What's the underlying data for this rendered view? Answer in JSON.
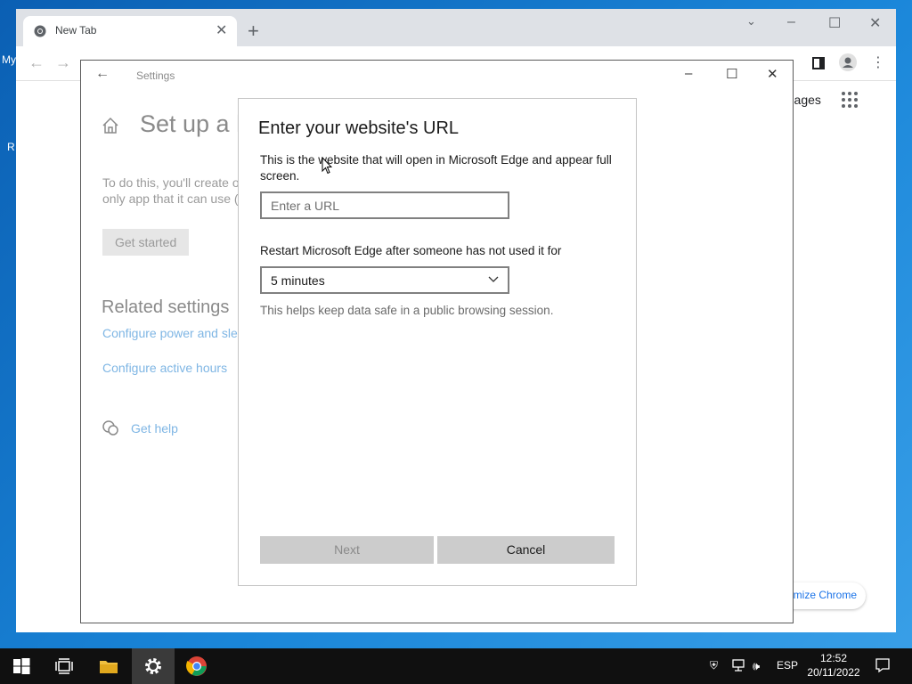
{
  "desktop": {
    "frag_top": "My",
    "frag_mid": "R"
  },
  "chrome": {
    "tab_title": "New Tab",
    "images_link": "Images",
    "customize_label": "omize Chrome"
  },
  "settings": {
    "window_title": "Settings",
    "heading": "Set up a k",
    "desc_line1": "To do this, you'll create o",
    "desc_line2": "only app that it can use (",
    "get_started": "Get started",
    "related_heading": "Related settings",
    "link_power": "Configure power and sle",
    "link_active_hours": "Configure active hours",
    "get_help": "Get help"
  },
  "dialog": {
    "title": "Enter your website's URL",
    "description": "This is the website that will open in Microsoft Edge and appear full screen.",
    "url_placeholder": "Enter a URL",
    "url_value": "",
    "restart_label": "Restart Microsoft Edge after someone has not used it for",
    "restart_selected": "5 minutes",
    "help_text": "This helps keep data safe in a public browsing session.",
    "next_label": "Next",
    "cancel_label": "Cancel"
  },
  "taskbar": {
    "language": "ESP",
    "time": "12:52",
    "date": "20/11/2022"
  },
  "colors": {
    "link": "#7fb6e4",
    "button_gray": "#cccccc",
    "taskbar": "#101010",
    "desktop": "#1a86d9"
  }
}
